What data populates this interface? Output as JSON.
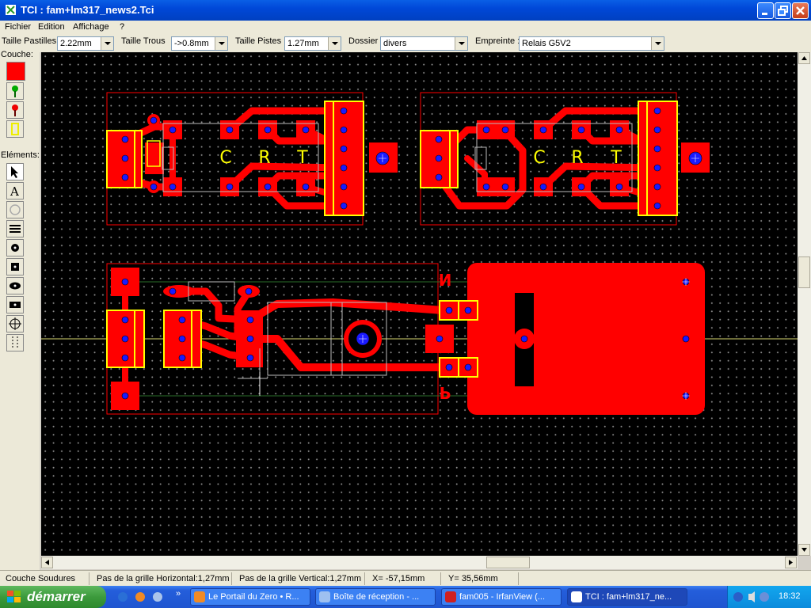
{
  "window": {
    "title": "TCI : fam+lm317_news2.Tci"
  },
  "menu": [
    "Fichier",
    "Edition",
    "Affichage",
    "?"
  ],
  "toolbar": {
    "pad_size_label": "Taille Pastilles",
    "pad_size_value": "2.22mm",
    "hole_size_label": "Taille Trous",
    "hole_size_value": "->0.8mm",
    "track_size_label": "Taille Pistes",
    "track_size_value": "1.27mm",
    "folder_label": "Dossier",
    "folder_value": "divers",
    "footprint_label": "Empreinte :",
    "footprint_value": "Relais G5V2"
  },
  "left_panel": {
    "layer_label": "Couche:",
    "elements_label": "Eléments:"
  },
  "board": {
    "silk_labels": [
      "C",
      "R",
      "T",
      "C",
      "R",
      "T"
    ],
    "mirrored_labels": [
      "N",
      "P"
    ],
    "colors": {
      "copper": "#ff0000",
      "silk": "#ffff00",
      "hole": "#0000ff",
      "background": "#000000",
      "grid": "#808080"
    }
  },
  "status": {
    "layer": "Couche Soudures",
    "grid_h": "Pas de la grille Horizontal:1,27mm",
    "grid_v": "Pas de la grille Vertical:1,27mm",
    "x": "X= -57,15mm",
    "y": "Y= 35,56mm"
  },
  "taskbar": {
    "start": "démarrer",
    "tasks": [
      "Le Portail du Zero • R...",
      "Boîte de réception - ...",
      "fam005 - IrfanView (...",
      "TCI : fam+lm317_ne..."
    ],
    "clock": "18:32"
  }
}
